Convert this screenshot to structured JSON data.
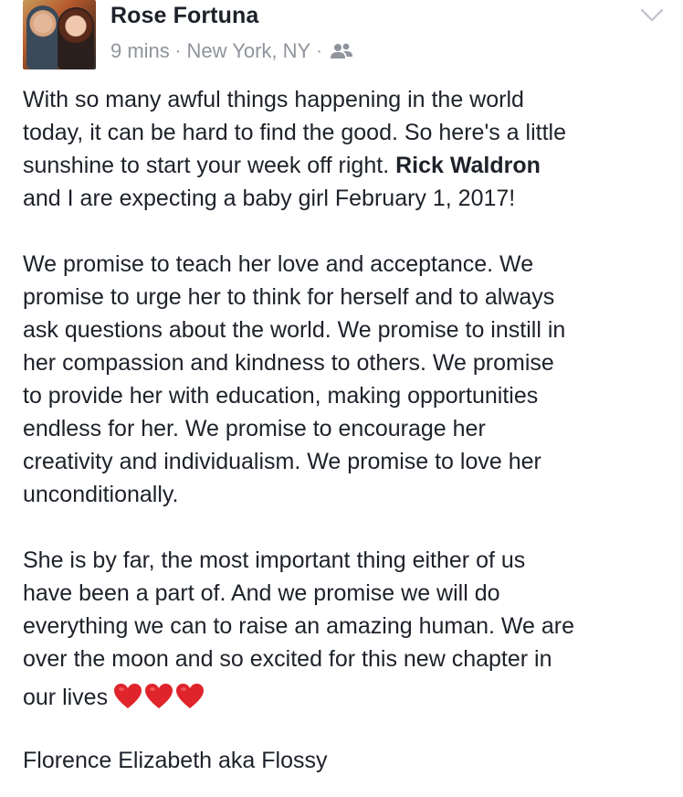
{
  "post": {
    "author_name": "Rose Fortuna",
    "time": "9 mins",
    "separator": "·",
    "location": "New York, NY",
    "audience_icon": "friends-icon",
    "menu_icon": "chevron-down-icon",
    "paragraphs": {
      "p1_before": "With so many awful things happening in the world\ntoday, it can be hard to find the good. So here's a little\nsunshine to start your week off right. ",
      "p1_mention": "Rick Waldron",
      "p1_after": "\nand I are expecting a baby girl February 1, 2017!",
      "p2": "We promise to teach her love and acceptance. We\npromise to urge her to think for herself and to always\nask questions about the world. We promise to instill in\nher compassion and kindness to others. We promise\nto provide her with education, making opportunities\nendless for her. We promise to encourage her\ncreativity and individualism. We promise to love her\nunconditionally.",
      "p3": "She is by far, the most important thing either of us\nhave been a part of. And we promise we will do\neverything we can to raise an amazing human. We are\nover the moon and so excited for this new chapter in",
      "p3_last": "our lives",
      "p4": "Florence Elizabeth aka Flossy"
    },
    "emoji": [
      "red-heart-icon",
      "red-heart-icon",
      "red-heart-icon"
    ],
    "colors": {
      "text": "#1d2129",
      "meta": "#90949c",
      "heart": "#e0242b"
    }
  }
}
